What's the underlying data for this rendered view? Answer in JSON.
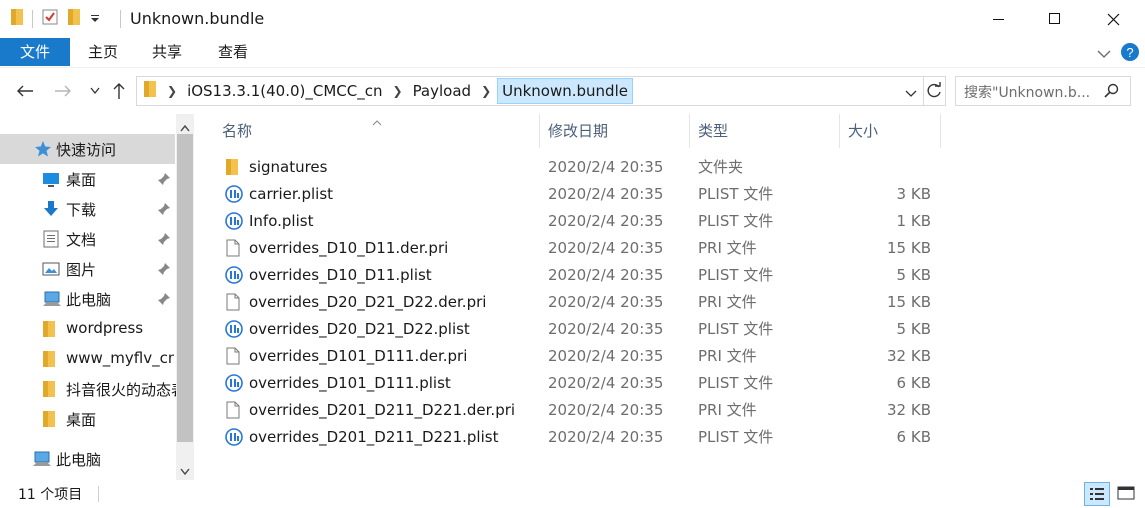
{
  "window": {
    "title": "Unknown.bundle",
    "controls": [
      "minimize",
      "maximize",
      "close"
    ]
  },
  "ribbon": {
    "tabs": [
      {
        "label": "文件",
        "active": true
      },
      {
        "label": "主页"
      },
      {
        "label": "共享"
      },
      {
        "label": "查看"
      }
    ]
  },
  "address": {
    "crumbs": [
      "iOS13.3.1(40.0)_CMCC_cn",
      "Payload",
      "Unknown.bundle"
    ],
    "search_placeholder": "搜索\"Unknown.b..."
  },
  "sidebar": {
    "items": [
      {
        "label": "快速访问",
        "icon": "star-icon",
        "selected": true,
        "indent": 0
      },
      {
        "label": "桌面",
        "icon": "desktop-icon",
        "pinned": true,
        "indent": 1
      },
      {
        "label": "下载",
        "icon": "download-icon",
        "pinned": true,
        "indent": 1
      },
      {
        "label": "文档",
        "icon": "document-icon",
        "pinned": true,
        "indent": 1
      },
      {
        "label": "图片",
        "icon": "pictures-icon",
        "pinned": true,
        "indent": 1
      },
      {
        "label": "此电脑",
        "icon": "computer-icon",
        "pinned": true,
        "indent": 1
      },
      {
        "label": "wordpress",
        "icon": "folder-icon",
        "indent": 1
      },
      {
        "label": "www_myflv_cn_",
        "icon": "folder-icon",
        "indent": 1
      },
      {
        "label": "抖音很火的动态表",
        "icon": "folder-icon",
        "indent": 1
      },
      {
        "label": "桌面",
        "icon": "folder-icon",
        "indent": 1
      },
      {
        "label": "此电脑",
        "icon": "computer-icon",
        "indent": 0
      }
    ]
  },
  "columns": {
    "name": "名称",
    "date": "修改日期",
    "type": "类型",
    "size": "大小"
  },
  "files": [
    {
      "name": "signatures",
      "date": "2020/2/4 20:35",
      "type": "文件夹",
      "size": "",
      "icon": "folder-icon"
    },
    {
      "name": "carrier.plist",
      "date": "2020/2/4 20:35",
      "type": "PLIST 文件",
      "size": "3 KB",
      "icon": "plist-icon"
    },
    {
      "name": "Info.plist",
      "date": "2020/2/4 20:35",
      "type": "PLIST 文件",
      "size": "1 KB",
      "icon": "plist-icon"
    },
    {
      "name": "overrides_D10_D11.der.pri",
      "date": "2020/2/4 20:35",
      "type": "PRI 文件",
      "size": "15 KB",
      "icon": "file-icon"
    },
    {
      "name": "overrides_D10_D11.plist",
      "date": "2020/2/4 20:35",
      "type": "PLIST 文件",
      "size": "5 KB",
      "icon": "plist-icon"
    },
    {
      "name": "overrides_D20_D21_D22.der.pri",
      "date": "2020/2/4 20:35",
      "type": "PRI 文件",
      "size": "15 KB",
      "icon": "file-icon"
    },
    {
      "name": "overrides_D20_D21_D22.plist",
      "date": "2020/2/4 20:35",
      "type": "PLIST 文件",
      "size": "5 KB",
      "icon": "plist-icon"
    },
    {
      "name": "overrides_D101_D111.der.pri",
      "date": "2020/2/4 20:35",
      "type": "PRI 文件",
      "size": "32 KB",
      "icon": "file-icon"
    },
    {
      "name": "overrides_D101_D111.plist",
      "date": "2020/2/4 20:35",
      "type": "PLIST 文件",
      "size": "6 KB",
      "icon": "plist-icon"
    },
    {
      "name": "overrides_D201_D211_D221.der.pri",
      "date": "2020/2/4 20:35",
      "type": "PRI 文件",
      "size": "32 KB",
      "icon": "file-icon"
    },
    {
      "name": "overrides_D201_D211_D221.plist",
      "date": "2020/2/4 20:35",
      "type": "PLIST 文件",
      "size": "6 KB",
      "icon": "plist-icon"
    }
  ],
  "status": {
    "item_count": "11 个项目"
  },
  "colors": {
    "accent": "#1979ca",
    "folder": "#f2c14e",
    "selection": "#cce8ff"
  }
}
